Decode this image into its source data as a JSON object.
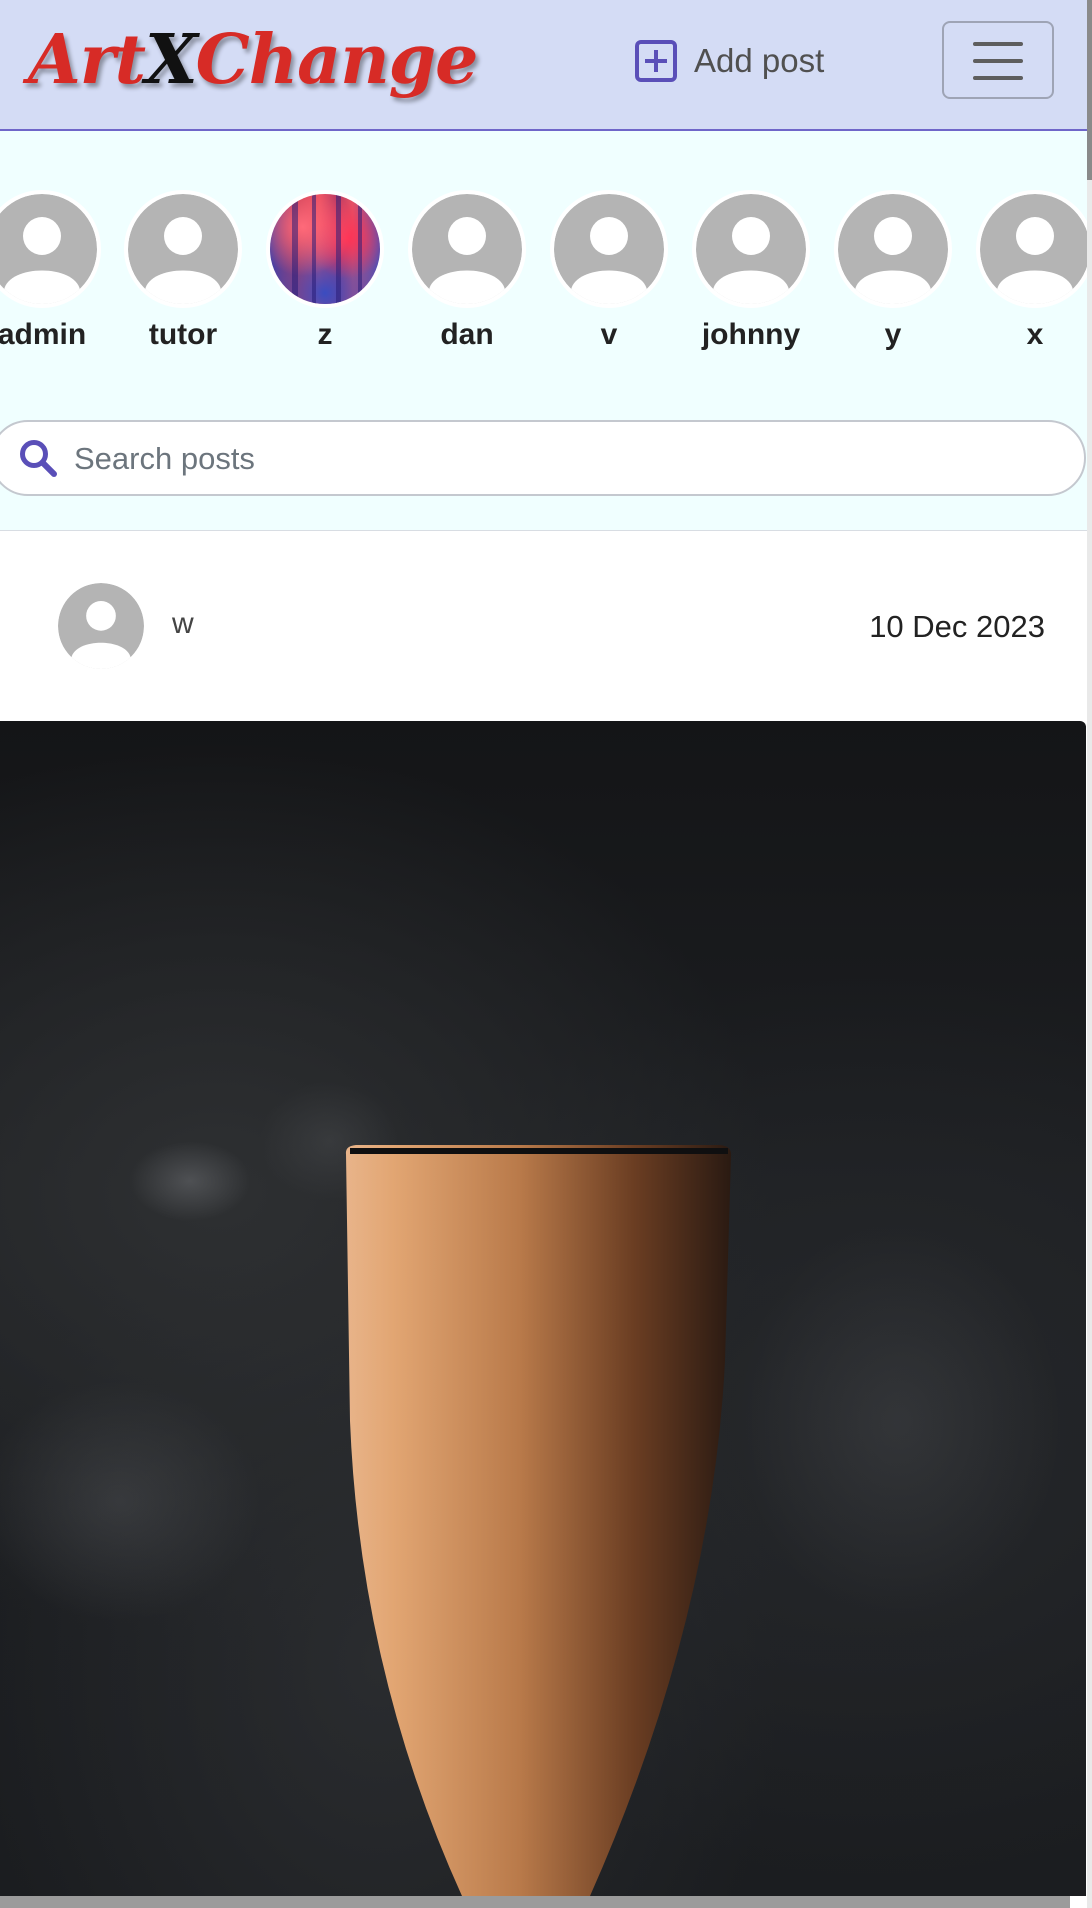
{
  "navbar": {
    "brand": {
      "part1": "Art",
      "part2": "X",
      "part3": "Change"
    },
    "add_post_label": "Add post",
    "menu_icon": "hamburger-icon"
  },
  "users": [
    {
      "name": "admin",
      "avatar": "default"
    },
    {
      "name": "tutor",
      "avatar": "default"
    },
    {
      "name": "z",
      "avatar": "photo"
    },
    {
      "name": "dan",
      "avatar": "default"
    },
    {
      "name": "v",
      "avatar": "default"
    },
    {
      "name": "johnny",
      "avatar": "default"
    },
    {
      "name": "y",
      "avatar": "default"
    },
    {
      "name": "x",
      "avatar": "default"
    }
  ],
  "search": {
    "placeholder": "Search posts",
    "value": ""
  },
  "post": {
    "author": "w",
    "date": "10 Dec 2023"
  },
  "colors": {
    "navbar_bg": "#d4dcf5",
    "accent": "#5a4fb8",
    "brand_red": "#d72b26",
    "stories_bg": "#f0ffff"
  }
}
